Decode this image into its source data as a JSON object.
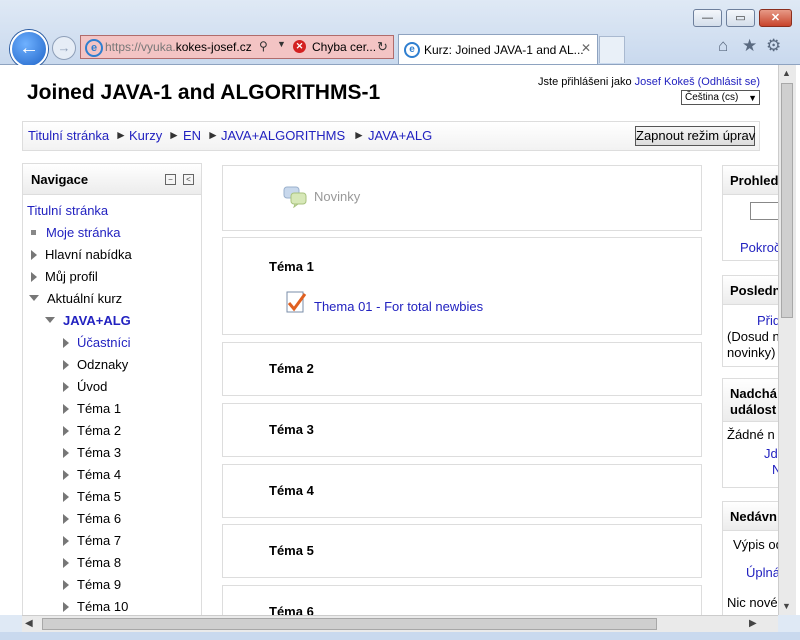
{
  "browser": {
    "url_prefix": "https://vyuka.",
    "url_domain": "kokes-josef.cz",
    "cert_error": "Chyba cer...",
    "tab_title": "Kurz: Joined JAVA-1 and AL...",
    "window_buttons": [
      "minimize-icon",
      "maximize-icon",
      "close-icon"
    ],
    "toolbar_icons": [
      "home-icon",
      "star-icon",
      "gear-icon"
    ]
  },
  "header": {
    "site_title": "Joined JAVA-1 and ALGORITHMS-1",
    "login_prefix": "Jste přihlášeni jako",
    "user_name": "Josef Kokeš",
    "logout": "(Odhlásit se)",
    "language": "Čeština (cs)"
  },
  "breadcrumb": {
    "items": [
      "Titulní stránka",
      "Kurzy",
      "EN",
      "JAVA+ALGORITHMS",
      "JAVA+ALG"
    ],
    "separator": "►",
    "edit_button": "Zapnout režim úprav"
  },
  "navigation": {
    "title": "Navigace",
    "home": "Titulní stránka",
    "my_page": "Moje stránka",
    "main_menu": "Hlavní nabídka",
    "my_profile": "Můj profil",
    "current_course": "Aktuální kurz",
    "course": "JAVA+ALG",
    "participants": "Účastníci",
    "badges": "Odznaky",
    "intro": "Úvod",
    "topics": [
      "Téma 1",
      "Téma 2",
      "Téma 3",
      "Téma 4",
      "Téma 5",
      "Téma 6",
      "Téma 7",
      "Téma 8",
      "Téma 9",
      "Téma 10"
    ]
  },
  "main": {
    "news": "Novinky",
    "sections": [
      "Téma 1",
      "Téma 2",
      "Téma 3",
      "Téma 4",
      "Téma 5",
      "Téma 6"
    ],
    "activity": "Thema 01 - For total newbies"
  },
  "right": {
    "search_title": "Prohled",
    "search_link": "Pokroč",
    "latest_title": "Posledn",
    "latest_link": "Přid",
    "latest_text1": "(Dosud n",
    "latest_text2": "novinky)",
    "events_title1": "Nadchá",
    "events_title2": "událost",
    "events_text": "Žádné n",
    "events_link1": "Jd",
    "events_link2": "N",
    "recent_title": "Nedávn",
    "recent_text1": "Výpis od",
    "recent_link": "Úplná",
    "recent_text2": "Nic nové",
    "recent_text3": "od"
  }
}
